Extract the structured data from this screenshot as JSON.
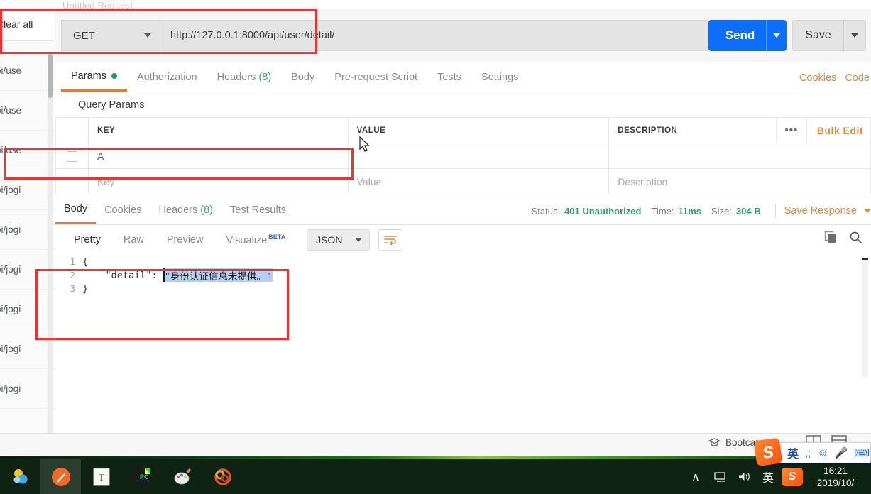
{
  "sidebar": {
    "clear_all": "Clear all",
    "items": [
      {
        "label": "pi/use"
      },
      {
        "label": "pi/use"
      },
      {
        "label": "pi/use"
      },
      {
        "label": "pi/jogi"
      },
      {
        "label": "pi/jogi"
      },
      {
        "label": "pi/jogi"
      },
      {
        "label": "pi/jogi"
      },
      {
        "label": "pi/jogi"
      },
      {
        "label": "pi/jogi"
      }
    ]
  },
  "request": {
    "title": "Untitled Request",
    "method": "GET",
    "url": "http://127.0.0.1:8000/api/user/detail/",
    "send_label": "Send",
    "save_label": "Save"
  },
  "request_tabs": [
    {
      "label": "Params",
      "active": true,
      "dot": true
    },
    {
      "label": "Authorization",
      "active": false
    },
    {
      "label": "Headers",
      "count": "(8)",
      "active": false
    },
    {
      "label": "Body",
      "active": false
    },
    {
      "label": "Pre-request Script",
      "active": false
    },
    {
      "label": "Tests",
      "active": false
    },
    {
      "label": "Settings",
      "active": false
    }
  ],
  "tabs_right": [
    {
      "label": "Cookies"
    },
    {
      "label": "Code"
    }
  ],
  "query_params": {
    "section_title": "Query Params",
    "columns": [
      "KEY",
      "VALUE",
      "DESCRIPTION"
    ],
    "bulk_edit_label": "Bulk Edit",
    "dots_label": "•••",
    "rows": [
      {
        "checked": false,
        "key": "A",
        "value": "",
        "description": "",
        "placeholder": false
      },
      {
        "checked": false,
        "key": "Key",
        "value": "Value",
        "description": "Description",
        "placeholder": true
      }
    ]
  },
  "response_tabs": [
    {
      "label": "Body",
      "active": true
    },
    {
      "label": "Cookies",
      "active": false
    },
    {
      "label": "Headers",
      "count": "(8)",
      "active": false
    },
    {
      "label": "Test Results",
      "active": false
    }
  ],
  "response_meta": {
    "status_key": "Status:",
    "status_value": "401 Unauthorized",
    "time_key": "Time:",
    "time_value": "11ms",
    "size_key": "Size:",
    "size_value": "304 B",
    "save_response": "Save Response"
  },
  "view_bar": {
    "tabs": [
      {
        "label": "Pretty",
        "active": true
      },
      {
        "label": "Raw",
        "active": false
      },
      {
        "label": "Preview",
        "active": false
      },
      {
        "label": "Visualize",
        "active": false,
        "badge": "BETA"
      }
    ],
    "format": "JSON",
    "wrap_icon": "word-wrap-icon",
    "copy_icon": "copy-icon",
    "search_icon": "search-icon"
  },
  "response_body": {
    "lines": [
      {
        "no": "1",
        "pre": "{",
        "sel": "",
        "post": ""
      },
      {
        "no": "2",
        "pre": "    \"detail\": ",
        "sel": "\"身份认证信息未提供。\"",
        "post": ""
      },
      {
        "no": "3",
        "pre": "}",
        "sel": "",
        "post": ""
      }
    ]
  },
  "status_strip": {
    "bootcamp_label": "Bootcamp"
  },
  "ime": {
    "logo": "S",
    "lang": "英",
    "punct_icon": "punctuation-icon",
    "emoji_icon": "emoji-icon",
    "mic_icon": "microphone-icon",
    "keyboard_icon": "keyboard-icon"
  },
  "taskbar": {
    "apps": [
      {
        "name": "app-icon-skype"
      },
      {
        "name": "app-icon-postman"
      },
      {
        "name": "app-icon-typora"
      },
      {
        "name": "app-icon-pycharm"
      },
      {
        "name": "app-icon-paint"
      },
      {
        "name": "app-icon-browser"
      }
    ],
    "tray": {
      "chevron": "∧",
      "network_icon": "network-icon",
      "volume_icon": "volume-icon",
      "lang": "英",
      "ime_icon": "sogou-ime-icon"
    },
    "clock": {
      "time": "16:21",
      "date": "2019/10/"
    }
  },
  "colors": {
    "accent_orange": "#e87b35",
    "link_orange": "#d98b4a",
    "send_blue": "#0d6efd",
    "status_green": "#2f9e73",
    "annotation_red": "#e8362c",
    "selection_blue": "#b3d0f2"
  }
}
